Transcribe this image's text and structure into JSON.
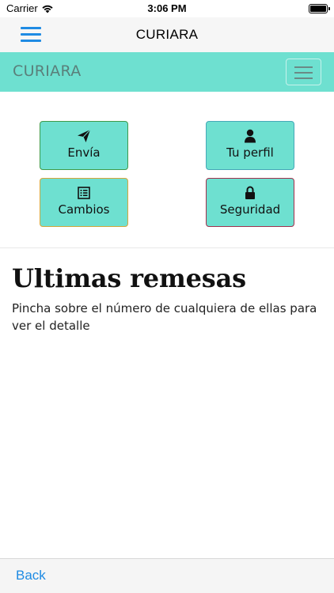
{
  "status_bar": {
    "carrier": "Carrier",
    "time": "3:06 PM"
  },
  "nav": {
    "title": "CURIARA"
  },
  "header": {
    "brand": "CURIARA"
  },
  "actions": [
    {
      "label": "Envía",
      "icon": "paper-plane-icon"
    },
    {
      "label": "Tu perfil",
      "icon": "user-icon"
    },
    {
      "label": "Cambios",
      "icon": "list-icon"
    },
    {
      "label": "Seguridad",
      "icon": "lock-icon"
    }
  ],
  "main": {
    "title": "Ultimas remesas",
    "description": "Pincha sobre el número de cualquiera de ellas para ver el detalle"
  },
  "bottom": {
    "back_label": "Back"
  },
  "colors": {
    "accent": "#6ee0d0",
    "link": "#1f8be3"
  }
}
